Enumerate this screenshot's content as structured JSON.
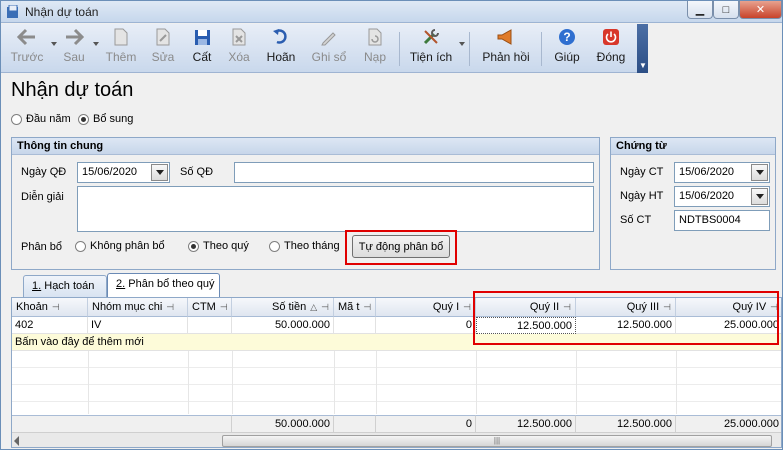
{
  "window": {
    "title": "Nhận dự toán"
  },
  "toolbar": {
    "items": [
      {
        "label": "Trước",
        "icon": "arrow-left-icon",
        "enabled": false
      },
      {
        "label": "Sau",
        "icon": "arrow-right-icon",
        "enabled": false
      },
      {
        "label": "Thêm",
        "icon": "new-document-icon",
        "enabled": false
      },
      {
        "label": "Sửa",
        "icon": "edit-document-icon",
        "enabled": false
      },
      {
        "label": "Cất",
        "icon": "save-icon",
        "enabled": true
      },
      {
        "label": "Xóa",
        "icon": "delete-icon",
        "enabled": false
      },
      {
        "label": "Hoãn",
        "icon": "undo-icon",
        "enabled": true
      },
      {
        "label": "Ghi sổ",
        "icon": "pencil-icon",
        "enabled": false
      },
      {
        "label": "Nạp",
        "icon": "reload-icon",
        "enabled": false
      },
      {
        "label": "Tiện ích",
        "icon": "tools-icon",
        "enabled": true
      },
      {
        "label": "Phản hồi",
        "icon": "megaphone-icon",
        "enabled": true
      },
      {
        "label": "Giúp",
        "icon": "help-icon",
        "enabled": true
      },
      {
        "label": "Đóng",
        "icon": "power-icon",
        "enabled": true
      }
    ]
  },
  "page": {
    "heading": "Nhận dự toán"
  },
  "type_options": {
    "option1": "Đầu năm",
    "option2": "Bổ sung",
    "selected": "Bổ sung"
  },
  "general": {
    "title": "Thông tin chung",
    "date_label": "Ngày QĐ",
    "date_value": "15/06/2020",
    "number_label": "Số QĐ",
    "number_value": "",
    "desc_label": "Diễn giải",
    "desc_value": "",
    "alloc_label": "Phân bổ",
    "alloc_opt1": "Không phân bổ",
    "alloc_opt2": "Theo quý",
    "alloc_opt3": "Theo tháng",
    "alloc_selected": "Theo quý",
    "auto_button": "Tự động phân bổ"
  },
  "voucher": {
    "title": "Chứng từ",
    "ct_date_label": "Ngày CT",
    "ct_date_value": "15/06/2020",
    "ht_date_label": "Ngày HT",
    "ht_date_value": "15/06/2020",
    "no_label": "Số CT",
    "no_value": "NDTBS0004"
  },
  "tabs": [
    {
      "num": "1.",
      "label": "Hạch toán",
      "active": false
    },
    {
      "num": "2.",
      "label": "Phân bổ theo quý",
      "active": true
    }
  ],
  "grid": {
    "headers": {
      "khoan": "Khoản",
      "nhom": "Nhóm mục chi",
      "ctm": "CTM",
      "sotien": "Số tiền",
      "mat": "Mã t",
      "q1": "Quý I",
      "q2": "Quý II",
      "q3": "Quý III",
      "q4": "Quý IV"
    },
    "row": {
      "khoan": "402",
      "nhom": "IV",
      "ctm": "",
      "sotien": "50.000.000",
      "mat": "",
      "q1": "0",
      "q2": "12.500.000",
      "q3": "12.500.000",
      "q4": "25.000.000"
    },
    "add_row_text": "Bấm vào đây để thêm mới",
    "totals": {
      "sotien": "50.000.000",
      "q1": "0",
      "q2": "12.500.000",
      "q3": "12.500.000",
      "q4": "25.000.000"
    }
  }
}
